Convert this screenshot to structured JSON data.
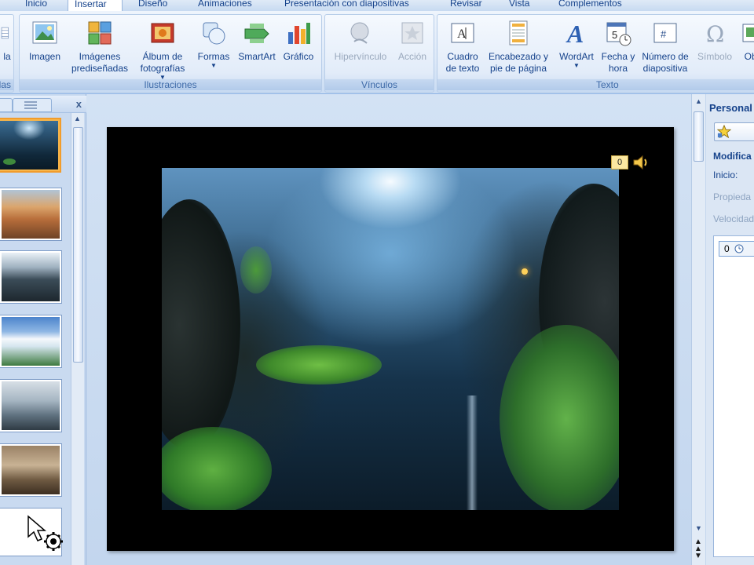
{
  "tabs": [
    "Inicio",
    "Insertar",
    "Diseño",
    "Animaciones",
    "Presentación con diapositivas",
    "Revisar",
    "Vista",
    "Complementos"
  ],
  "ribbon": {
    "partial_left": {
      "button": "la",
      "label": "las"
    },
    "illustrations": {
      "label": "Ilustraciones",
      "buttons": {
        "image": "Imagen",
        "clipart": "Imágenes prediseñadas",
        "album": "Álbum de fotografías",
        "shapes": "Formas",
        "smartart": "SmartArt",
        "chart": "Gráfico"
      }
    },
    "links": {
      "label": "Vínculos",
      "buttons": {
        "hyperlink": "Hipervínculo",
        "action": "Acción"
      }
    },
    "text": {
      "label": "Texto",
      "buttons": {
        "textbox": "Cuadro de texto",
        "header": "Encabezado y pie de página",
        "wordart": "WordArt",
        "datetime": "Fecha y hora",
        "slidenum": "Número de diapositiva",
        "symbol": "Símbolo",
        "object": "Obj"
      }
    }
  },
  "slides_pane": {
    "close": "x"
  },
  "slide": {
    "sound_order": "0"
  },
  "task_pane": {
    "title": "Personal",
    "modify": "Modifica",
    "start": "Inicio:",
    "property": "Propieda",
    "speed": "Velocidad",
    "item_number": "0"
  },
  "colors": {
    "ribbon_text": "#15428b",
    "accent": "#f29c2b",
    "slide_bg": "#000000"
  }
}
